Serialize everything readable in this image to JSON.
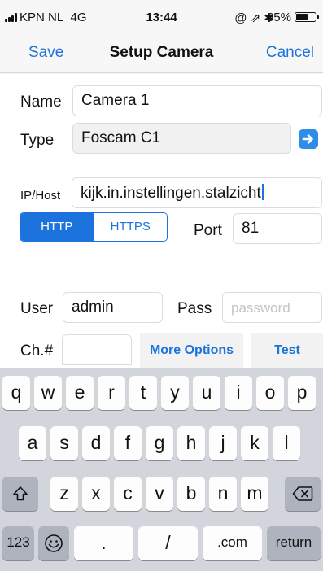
{
  "status_bar": {
    "carrier": "KPN NL",
    "network": "4G",
    "time": "13:44",
    "right_icons": "@ ⇗ ✱",
    "battery_percent": "65%",
    "battery_level": 0.65
  },
  "nav": {
    "left": "Save",
    "title": "Setup Camera",
    "right": "Cancel"
  },
  "form": {
    "name_label": "Name",
    "name_value": "Camera 1",
    "type_label": "Type",
    "type_value": "Foscam C1",
    "host_label": "IP/Host",
    "host_value": "kijk.in.instellingen.stalzicht",
    "protocol": {
      "options": [
        "HTTP",
        "HTTPS"
      ],
      "selected": "HTTP"
    },
    "port_label": "Port",
    "port_value": "81",
    "user_label": "User",
    "user_value": "admin",
    "pass_label": "Pass",
    "pass_placeholder": "password",
    "channel_label": "Ch.#",
    "channel_value": "",
    "more_options": "More Options",
    "test": "Test"
  },
  "keyboard": {
    "row1": [
      "q",
      "w",
      "e",
      "r",
      "t",
      "y",
      "u",
      "i",
      "o",
      "p"
    ],
    "row2": [
      "a",
      "s",
      "d",
      "f",
      "g",
      "h",
      "j",
      "k",
      "l"
    ],
    "row3": [
      "z",
      "x",
      "c",
      "v",
      "b",
      "n",
      "m"
    ],
    "numbers": "123",
    "dot": ".",
    "slash": "/",
    "dotcom": ".com",
    "return": "return"
  },
  "colors": {
    "accent": "#1d73dd",
    "keyboard_bg": "#d2d5db",
    "key_dark": "#aeb3be"
  }
}
